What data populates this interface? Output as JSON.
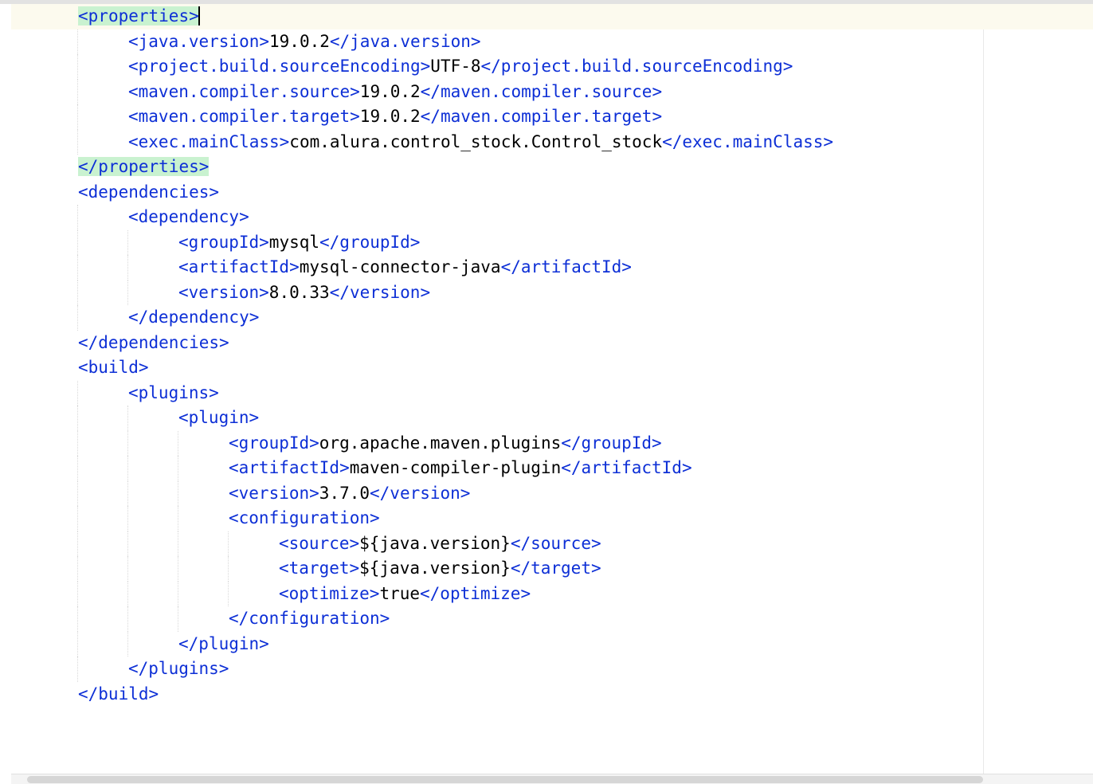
{
  "editor": {
    "lines": [
      {
        "indent": 1,
        "highlightLine": true,
        "segments": [
          {
            "t": "tag",
            "v": "<",
            "hl": true
          },
          {
            "t": "tag",
            "v": "properties",
            "hl": true
          },
          {
            "t": "tag",
            "v": ">",
            "hl": true
          }
        ],
        "caretAfter": true
      },
      {
        "indent": 2,
        "segments": [
          {
            "t": "tag",
            "v": "<java.version>"
          },
          {
            "t": "txt",
            "v": "19.0.2"
          },
          {
            "t": "tag",
            "v": "</java.version>"
          }
        ]
      },
      {
        "indent": 2,
        "segments": [
          {
            "t": "tag",
            "v": "<project.build.sourceEncoding>"
          },
          {
            "t": "txt",
            "v": "UTF-8"
          },
          {
            "t": "tag",
            "v": "</project.build.sourceEncoding>"
          }
        ]
      },
      {
        "indent": 2,
        "segments": [
          {
            "t": "tag",
            "v": "<maven.compiler.source>"
          },
          {
            "t": "txt",
            "v": "19.0.2"
          },
          {
            "t": "tag",
            "v": "</maven.compiler.source>"
          }
        ]
      },
      {
        "indent": 2,
        "segments": [
          {
            "t": "tag",
            "v": "<maven.compiler.target>"
          },
          {
            "t": "txt",
            "v": "19.0.2"
          },
          {
            "t": "tag",
            "v": "</maven.compiler.target>"
          }
        ]
      },
      {
        "indent": 2,
        "segments": [
          {
            "t": "tag",
            "v": "<exec.mainClass>"
          },
          {
            "t": "txt",
            "v": "com.alura.control_stock.Control_stock"
          },
          {
            "t": "tag",
            "v": "</exec.mainClass>"
          }
        ]
      },
      {
        "indent": 1,
        "segments": [
          {
            "t": "tag",
            "v": "</",
            "hl": true
          },
          {
            "t": "tag",
            "v": "properties",
            "hl": true
          },
          {
            "t": "tag",
            "v": ">",
            "hl": true
          }
        ]
      },
      {
        "indent": 1,
        "segments": [
          {
            "t": "tag",
            "v": "<dependencies>"
          }
        ]
      },
      {
        "indent": 2,
        "segments": [
          {
            "t": "tag",
            "v": "<dependency>"
          }
        ]
      },
      {
        "indent": 3,
        "segments": [
          {
            "t": "tag",
            "v": "<groupId>"
          },
          {
            "t": "txt",
            "v": "mysql"
          },
          {
            "t": "tag",
            "v": "</groupId>"
          }
        ]
      },
      {
        "indent": 3,
        "segments": [
          {
            "t": "tag",
            "v": "<artifactId>"
          },
          {
            "t": "txt",
            "v": "mysql-connector-java"
          },
          {
            "t": "tag",
            "v": "</artifactId>"
          }
        ]
      },
      {
        "indent": 3,
        "segments": [
          {
            "t": "tag",
            "v": "<version>"
          },
          {
            "t": "txt",
            "v": "8.0.33"
          },
          {
            "t": "tag",
            "v": "</version>"
          }
        ]
      },
      {
        "indent": 2,
        "segments": [
          {
            "t": "tag",
            "v": "</dependency>"
          }
        ]
      },
      {
        "indent": 1,
        "segments": [
          {
            "t": "tag",
            "v": "</dependencies>"
          }
        ]
      },
      {
        "indent": 1,
        "segments": [
          {
            "t": "tag",
            "v": "<build>"
          }
        ]
      },
      {
        "indent": 2,
        "segments": [
          {
            "t": "tag",
            "v": "<plugins>"
          }
        ]
      },
      {
        "indent": 3,
        "segments": [
          {
            "t": "tag",
            "v": "<plugin>"
          }
        ]
      },
      {
        "indent": 4,
        "segments": [
          {
            "t": "tag",
            "v": "<groupId>"
          },
          {
            "t": "txt",
            "v": "org.apache.maven.plugins"
          },
          {
            "t": "tag",
            "v": "</groupId>"
          }
        ]
      },
      {
        "indent": 4,
        "segments": [
          {
            "t": "tag",
            "v": "<artifactId>"
          },
          {
            "t": "txt",
            "v": "maven-compiler-plugin"
          },
          {
            "t": "tag",
            "v": "</artifactId>"
          }
        ]
      },
      {
        "indent": 4,
        "segments": [
          {
            "t": "tag",
            "v": "<version>"
          },
          {
            "t": "txt",
            "v": "3.7.0"
          },
          {
            "t": "tag",
            "v": "</version>"
          }
        ]
      },
      {
        "indent": 4,
        "segments": [
          {
            "t": "tag",
            "v": "<configuration>"
          }
        ]
      },
      {
        "indent": 5,
        "segments": [
          {
            "t": "tag",
            "v": "<source>"
          },
          {
            "t": "txt",
            "v": "${java.version}"
          },
          {
            "t": "tag",
            "v": "</source>"
          }
        ]
      },
      {
        "indent": 5,
        "segments": [
          {
            "t": "tag",
            "v": "<target>"
          },
          {
            "t": "txt",
            "v": "${java.version}"
          },
          {
            "t": "tag",
            "v": "</target>"
          }
        ]
      },
      {
        "indent": 5,
        "segments": [
          {
            "t": "tag",
            "v": "<optimize>"
          },
          {
            "t": "txt",
            "v": "true"
          },
          {
            "t": "tag",
            "v": "</optimize>"
          }
        ]
      },
      {
        "indent": 4,
        "segments": [
          {
            "t": "tag",
            "v": "</configuration>"
          }
        ]
      },
      {
        "indent": 3,
        "segments": [
          {
            "t": "tag",
            "v": "</plugin>"
          }
        ]
      },
      {
        "indent": 2,
        "segments": [
          {
            "t": "tag",
            "v": "</plugins>"
          }
        ]
      },
      {
        "indent": 1,
        "segments": [
          {
            "t": "tag",
            "v": "</build>"
          }
        ]
      }
    ]
  }
}
